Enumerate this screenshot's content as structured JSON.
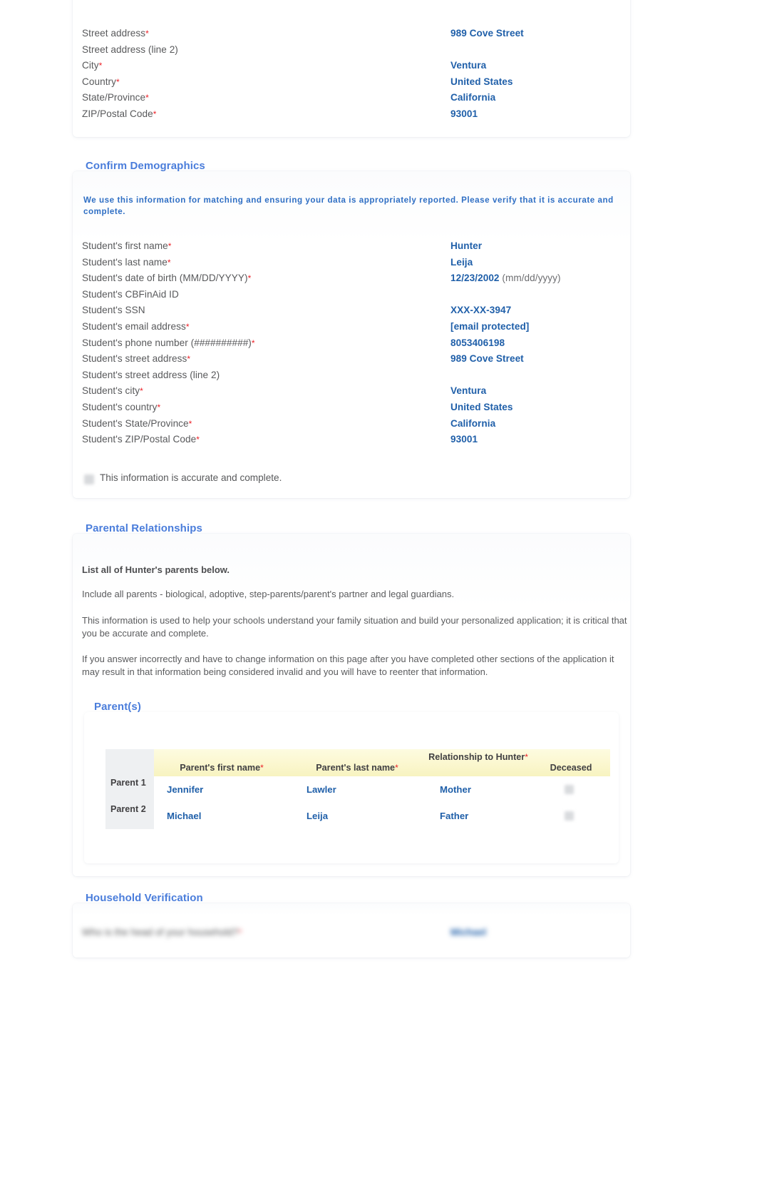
{
  "address_card": {
    "rows": [
      {
        "label": "Street address",
        "required": true,
        "value": "989 Cove Street"
      },
      {
        "label": "Street address (line 2)",
        "required": false,
        "value": ""
      },
      {
        "label": "City",
        "required": true,
        "value": "Ventura"
      },
      {
        "label": "Country",
        "required": true,
        "value": "United States"
      },
      {
        "label": "State/Province",
        "required": true,
        "value": "California"
      },
      {
        "label": "ZIP/Postal Code",
        "required": true,
        "value": "93001"
      }
    ]
  },
  "demographics": {
    "title": "Confirm Demographics",
    "note": "We use this information for matching and ensuring your data is appropriately reported. Please verify that it is accurate and complete.",
    "rows": [
      {
        "label": "Student's first name",
        "required": true,
        "value": "Hunter",
        "hint": ""
      },
      {
        "label": "Student's last name",
        "required": true,
        "value": "Leija",
        "hint": ""
      },
      {
        "label": "Student's date of birth (MM/DD/YYYY)",
        "required": true,
        "value": "12/23/2002",
        "hint": "(mm/dd/yyyy)"
      },
      {
        "label": "Student's CBFinAid ID",
        "required": false,
        "value": "",
        "hint": ""
      },
      {
        "label": "Student's SSN",
        "required": false,
        "value": "XXX-XX-3947",
        "hint": ""
      },
      {
        "label": "Student's email address",
        "required": true,
        "value": "[email protected]",
        "hint": ""
      },
      {
        "label": "Student's phone number (##########)",
        "required": true,
        "value": "8053406198",
        "hint": ""
      },
      {
        "label": "Student's street address",
        "required": true,
        "value": "989 Cove Street",
        "hint": ""
      },
      {
        "label": "Student's street address (line 2)",
        "required": false,
        "value": "",
        "hint": ""
      },
      {
        "label": "Student's city",
        "required": true,
        "value": "Ventura",
        "hint": ""
      },
      {
        "label": "Student's country",
        "required": true,
        "value": "United States",
        "hint": ""
      },
      {
        "label": "Student's State/Province",
        "required": true,
        "value": "California",
        "hint": ""
      },
      {
        "label": "Student's ZIP/Postal Code",
        "required": true,
        "value": "93001",
        "hint": ""
      }
    ],
    "confirm_checkbox_label": "This information is accurate and complete."
  },
  "parental": {
    "title": "Parental Relationships",
    "lead": "List all of Hunter's parents below.",
    "para1": "Include all parents - biological, adoptive, step-parents/parent's partner and legal guardians.",
    "para2": "This information is used to help your schools understand your family situation and build your personalized application; it is critical that you be accurate and complete.",
    "para3": "If you answer incorrectly and have to change information on this page after you have completed other sections of the application it may result in that information being considered invalid and you will have to reenter that information.",
    "subtitle": "Parent(s)",
    "table": {
      "columns": [
        {
          "label": "Parent's first name",
          "required": true
        },
        {
          "label": "Parent's last name",
          "required": true
        },
        {
          "label": "Relationship to Hunter",
          "required": true
        },
        {
          "label": "Deceased",
          "required": false
        }
      ],
      "rows": [
        {
          "row_label": "Parent 1",
          "first_name": "Jennifer",
          "last_name": "Lawler",
          "relationship": "Mother",
          "deceased": false
        },
        {
          "row_label": "Parent 2",
          "first_name": "Michael",
          "last_name": "Leija",
          "relationship": "Father",
          "deceased": false
        }
      ]
    }
  },
  "household": {
    "title": "Household Verification",
    "question": "Who is the head of your household?",
    "answer": "Michael"
  }
}
